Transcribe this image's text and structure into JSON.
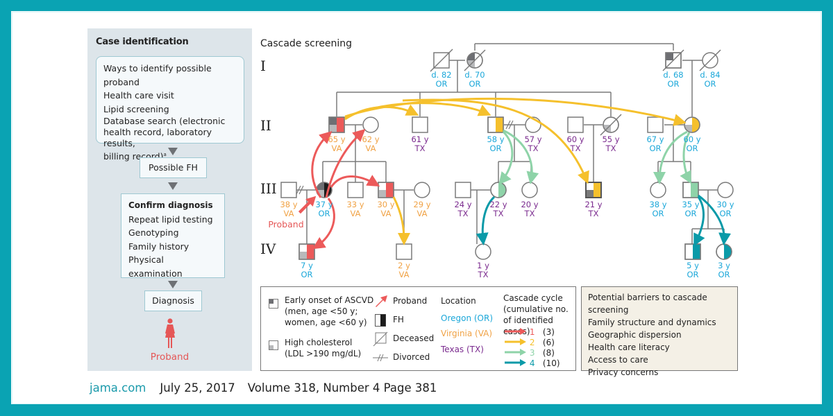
{
  "left_panel": {
    "title": "Case identification",
    "ways_box": [
      "Ways to identify possible proband",
      "Health care visit",
      "Lipid screening",
      "Database search (electronic",
      "health record, laboratory results,",
      "billing record)"
    ],
    "ways_superscript": "a",
    "possible_fh": "Possible FH",
    "confirm_title": "Confirm diagnosis",
    "confirm_items": [
      "Repeat lipid testing",
      "Genotyping",
      "Family history",
      "Physical examination"
    ],
    "diagnosis": "Diagnosis",
    "proband_label": "Proband"
  },
  "pedigree": {
    "title": "Cascade screening",
    "generations": [
      "I",
      "II",
      "III",
      "IV"
    ],
    "proband_arrow_label": "Proband",
    "individuals": [
      {
        "id": "I-1",
        "age": "d. 82",
        "loc": "OR"
      },
      {
        "id": "I-2",
        "age": "d. 70",
        "loc": "OR"
      },
      {
        "id": "I-3",
        "age": "d. 68",
        "loc": "OR"
      },
      {
        "id": "I-4",
        "age": "d. 84",
        "loc": "OR"
      },
      {
        "id": "II-1",
        "age": "65 y",
        "loc": "VA"
      },
      {
        "id": "II-2",
        "age": "62 y",
        "loc": "VA"
      },
      {
        "id": "II-3",
        "age": "61 y",
        "loc": "TX"
      },
      {
        "id": "II-4",
        "age": "58 y",
        "loc": "OR"
      },
      {
        "id": "II-5",
        "age": "57 y",
        "loc": "TX"
      },
      {
        "id": "II-6",
        "age": "60 y",
        "loc": "TX"
      },
      {
        "id": "II-7",
        "age": "55 y",
        "loc": "TX"
      },
      {
        "id": "II-8",
        "age": "67 y",
        "loc": "OR"
      },
      {
        "id": "II-9",
        "age": "60 y",
        "loc": "OR"
      },
      {
        "id": "III-1",
        "age": "38 y",
        "loc": "VA"
      },
      {
        "id": "III-2",
        "age": "37 y",
        "loc": "OR"
      },
      {
        "id": "III-3",
        "age": "33 y",
        "loc": "VA"
      },
      {
        "id": "III-4",
        "age": "30 y",
        "loc": "VA"
      },
      {
        "id": "III-5",
        "age": "29 y",
        "loc": "VA"
      },
      {
        "id": "III-6",
        "age": "24 y",
        "loc": "TX"
      },
      {
        "id": "III-7",
        "age": "22 y",
        "loc": "TX"
      },
      {
        "id": "III-8",
        "age": "20 y",
        "loc": "TX"
      },
      {
        "id": "III-9",
        "age": "21 y",
        "loc": "TX"
      },
      {
        "id": "III-10",
        "age": "38 y",
        "loc": "OR"
      },
      {
        "id": "III-11",
        "age": "35 y",
        "loc": "OR"
      },
      {
        "id": "III-12",
        "age": "30 y",
        "loc": "OR"
      },
      {
        "id": "IV-1",
        "age": "7 y",
        "loc": "OR"
      },
      {
        "id": "IV-2",
        "age": "2 y",
        "loc": "VA"
      },
      {
        "id": "IV-3",
        "age": "1 y",
        "loc": "TX"
      },
      {
        "id": "IV-4",
        "age": "5 y",
        "loc": "OR"
      },
      {
        "id": "IV-5",
        "age": "3 y",
        "loc": "OR"
      }
    ]
  },
  "legend": {
    "ascvd": [
      "Early onset of ASCVD",
      "(men, age <50 y;",
      "women, age <60 y)"
    ],
    "cholesterol": [
      "High cholesterol",
      "(LDL >190 mg/dL)"
    ],
    "proband": "Proband",
    "fh": "FH",
    "deceased": "Deceased",
    "divorced": "Divorced",
    "location_title": "Location",
    "locations": [
      {
        "label": "Oregon (OR)",
        "color": "#1ba7d9"
      },
      {
        "label": "Virginia (VA)",
        "color": "#f0a245"
      },
      {
        "label": "Texas (TX)",
        "color": "#7a2a8e"
      }
    ],
    "cascade_title": [
      "Cascade cycle",
      "(cumulative no.",
      "of identified cases)"
    ],
    "cycles": [
      {
        "num": "1",
        "count": "(3)",
        "color": "#ec5a5a"
      },
      {
        "num": "2",
        "count": "(6)",
        "color": "#f5c02c"
      },
      {
        "num": "3",
        "count": "(8)",
        "color": "#8ed3a8"
      },
      {
        "num": "4",
        "count": "(10)",
        "color": "#0a9aa8"
      }
    ]
  },
  "barriers": {
    "title": "Potential barriers to cascade screening",
    "items": [
      "Family structure and dynamics",
      "Geographic dispersion",
      "Health care literacy",
      "Access to care",
      "Privacy concerns"
    ]
  },
  "footer": {
    "site": "jama.com",
    "date": "July 25, 2017",
    "issue": "Volume 318, Number 4 Page 381"
  }
}
